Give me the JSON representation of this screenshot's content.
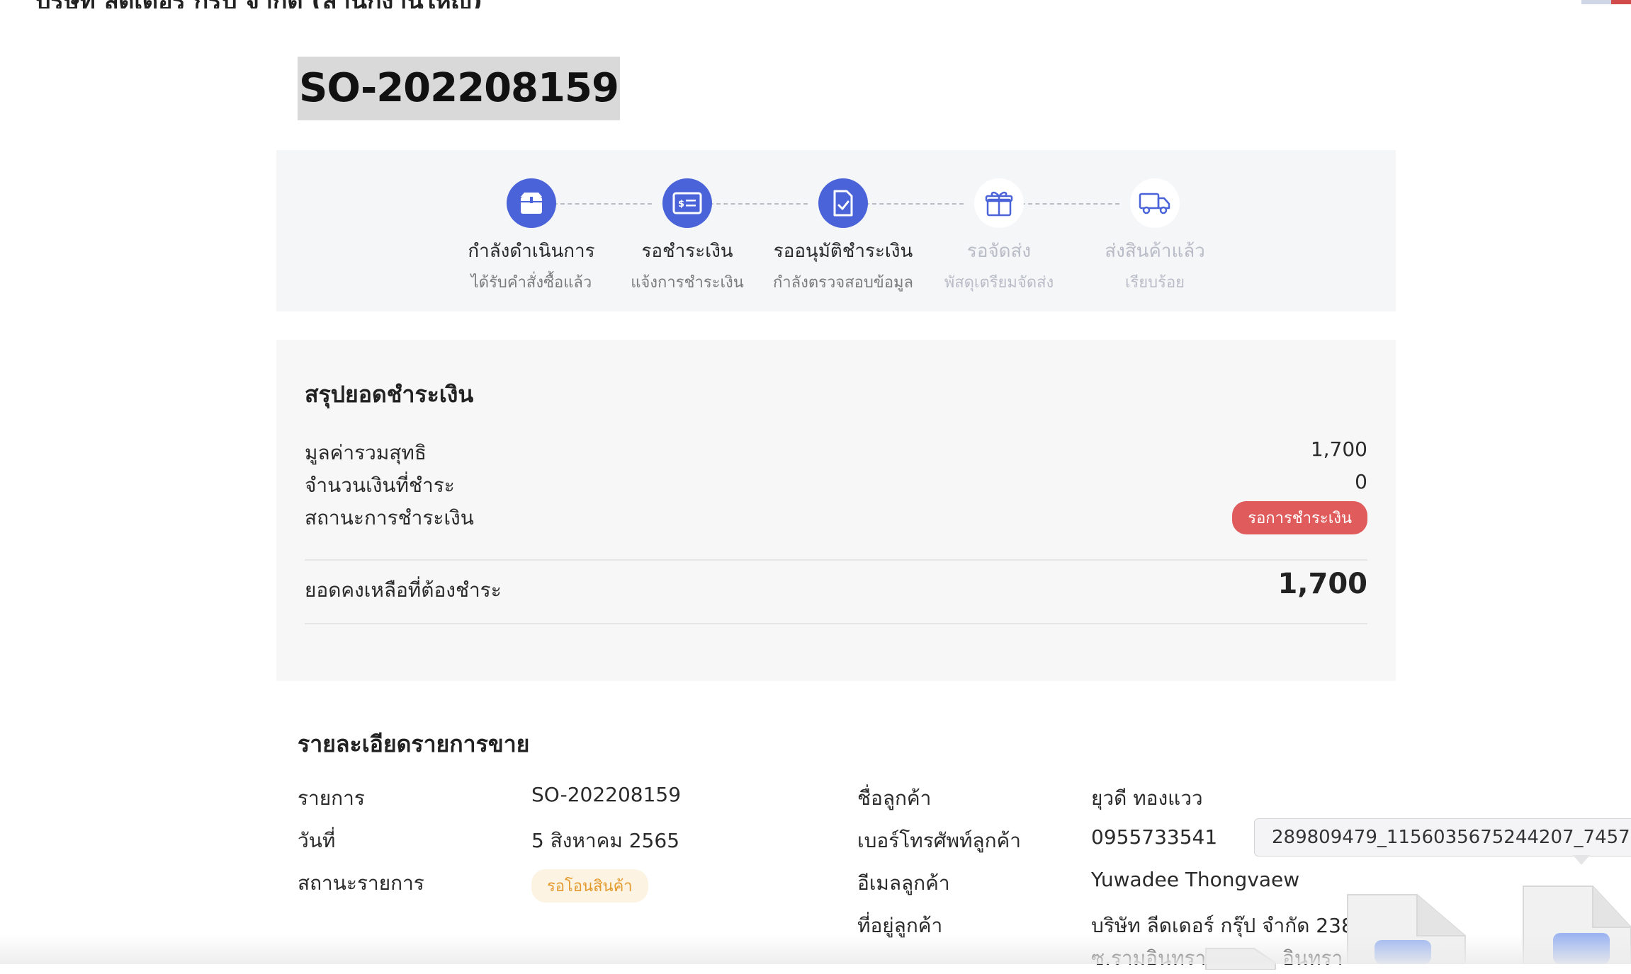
{
  "header": {
    "company": "บริษัท ลีดเดอร์ กรุ๊ป จำกัด (สำนักงานใหญ่)"
  },
  "order": {
    "id": "SO-202208159"
  },
  "steps": [
    {
      "label": "กำลังดำเนินการ",
      "sub": "ได้รับคำสั่งซื้อแล้ว",
      "icon": "box-icon",
      "active": true
    },
    {
      "label": "รอชำระเงิน",
      "sub": "แจ้งการชำระเงิน",
      "icon": "bill-icon",
      "active": true
    },
    {
      "label": "รออนุมัติชำระเงิน",
      "sub": "กำลังตรวจสอบข้อมูล",
      "icon": "document-check-icon",
      "active": true
    },
    {
      "label": "รอจัดส่ง",
      "sub": "พัสดุเตรียมจัดส่ง",
      "icon": "gift-icon",
      "active": false
    },
    {
      "label": "ส่งสินค้าแล้ว",
      "sub": "เรียบร้อย",
      "icon": "truck-icon",
      "active": false
    }
  ],
  "summary": {
    "title": "สรุปยอดชำระเงิน",
    "net_total_label": "มูลค่ารวมสุทธิ",
    "net_total_value": "1,700",
    "paid_label": "จำนวนเงินที่ชำระ",
    "paid_value": "0",
    "status_label": "สถานะการชำระเงิน",
    "status_value": "รอการชำระเงิน",
    "balance_label": "ยอดคงเหลือที่ต้องชำระ",
    "balance_value": "1,700"
  },
  "details": {
    "title": "รายละเอียดรายการขาย",
    "item_label": "รายการ",
    "item_value": "SO-202208159",
    "date_label": "วันที่",
    "date_value": "5 สิงหาคม 2565",
    "status_label": "สถานะรายการ",
    "status_value": "รอโอนสินค้า",
    "customer_name_label": "ชื่อลูกค้า",
    "customer_name_value": "ยุวดี ทองแวว",
    "customer_phone_label": "เบอร์โทรศัพท์ลูกค้า",
    "customer_phone_value": "0955733541",
    "customer_email_label": "อีเมลลูกค้า",
    "customer_email_value": "Yuwadee Thongvaew",
    "customer_address_label": "ที่อยู่ลูกค้า",
    "customer_address_line1": "บริษัท ลีดเดอร์ กรุ๊ป จำกัด 238",
    "customer_address_line2": "ซ.รามอินทรา (",
    "customer_address_tail": "อินทรา"
  },
  "tooltip": {
    "text": "289809479_1156035675244207_7457"
  },
  "colors": {
    "accent": "#4a63d8",
    "danger": "#e05b5b",
    "warning_text": "#e39a2e"
  }
}
